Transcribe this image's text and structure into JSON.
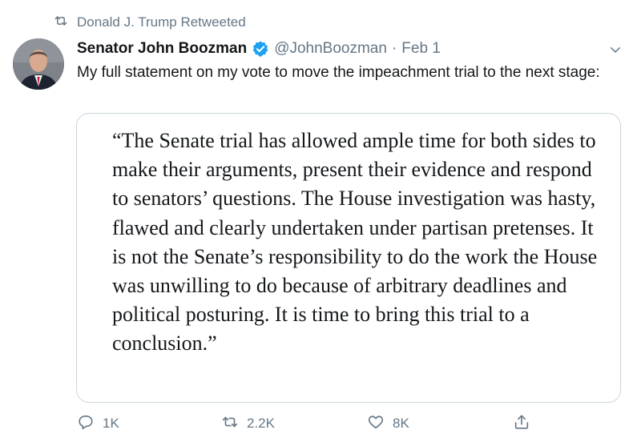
{
  "retweet": {
    "icon": "retweet-icon",
    "label": "Donald J. Trump Retweeted"
  },
  "author": {
    "name": "Senator John Boozman",
    "verified": true,
    "handle": "@JohnBoozman",
    "separator": "·",
    "date": "Feb 1"
  },
  "tweet": {
    "text": "My full statement on my vote to move the impeachment trial to the next stage:"
  },
  "quote_card": {
    "text": "“The Senate trial has allowed ample time for both sides to make their arguments, present their evidence and respond to senators’ questions. The House investigation was hasty, flawed and clearly undertaken under partisan pretenses. It is not the Senate’s responsibility to do the work the House was unwilling to do because of arbitrary deadlines and political posturing. It is time to bring this trial to a conclusion.”"
  },
  "actions": {
    "reply_count": "1K",
    "retweet_count": "2.2K",
    "like_count": "8K"
  },
  "colors": {
    "text": "#14171a",
    "secondary": "#657786",
    "verified": "#1da1f2",
    "border": "#ccd6dd"
  }
}
